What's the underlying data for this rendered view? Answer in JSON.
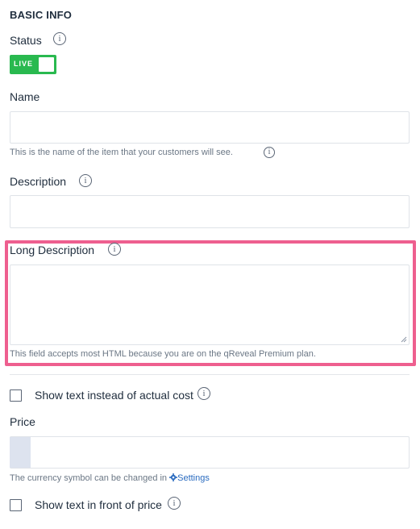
{
  "section": {
    "title": "BASIC INFO"
  },
  "status": {
    "label": "Status",
    "toggle_text": "LIVE"
  },
  "name": {
    "label": "Name",
    "value": "",
    "help": "This is the name of the item that your customers will see."
  },
  "description": {
    "label": "Description",
    "value": ""
  },
  "long_description": {
    "label": "Long Description",
    "value": "",
    "help": "This field accepts most HTML because you are on the qReveal Premium plan."
  },
  "show_text_cost": {
    "label": "Show text instead of actual cost",
    "checked": false
  },
  "price": {
    "label": "Price",
    "value": "",
    "help_prefix": "The currency symbol can be changed in ",
    "settings_link": "Settings"
  },
  "show_text_price": {
    "label": "Show text in front of price",
    "checked": false
  },
  "colors": {
    "toggle_on": "#29b94f",
    "highlight": "#ee5f8f",
    "link": "#2a6bbf"
  },
  "icons": [
    "info-icon",
    "gear-icon",
    "resize-handle-icon"
  ]
}
